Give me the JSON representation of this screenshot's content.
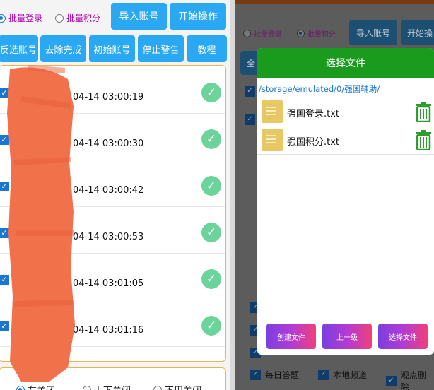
{
  "left": {
    "mode_options": [
      {
        "label": "批量登录",
        "selected": true
      },
      {
        "label": "批量积分",
        "selected": false
      }
    ],
    "import_button": "导入账号",
    "start_button": "开始操作",
    "toolbar": [
      "反选账号",
      "去除完成",
      "初始账号",
      "停止警告",
      "教程"
    ],
    "accounts": [
      {
        "time": "04-14 03:00:19",
        "checked": true,
        "done": true
      },
      {
        "time": "04-14 03:00:30",
        "checked": true,
        "done": true
      },
      {
        "time": "04-14 03:00:42",
        "checked": true,
        "done": true
      },
      {
        "time": "04-14 03:00:53",
        "checked": true,
        "done": true
      },
      {
        "time": "04-14 03:01:05",
        "checked": true,
        "done": true
      },
      {
        "time": "04-14 03:01:16",
        "checked": true,
        "done": true
      }
    ],
    "close_options": [
      "左关闭",
      "上下关闭",
      "不用关闭"
    ]
  },
  "right_background": {
    "mode_options": [
      {
        "label": "批量登录",
        "selected": false
      },
      {
        "label": "批量积分",
        "selected": true
      }
    ],
    "import_button": "导入账号",
    "start_button": "开始操",
    "side_button": "全",
    "bottom_options": [
      {
        "label": "每日答题",
        "checked": true
      },
      {
        "label": "本地频道",
        "checked": true
      },
      {
        "label": "观点删除",
        "checked": true
      }
    ]
  },
  "dialog": {
    "title": "选择文件",
    "path": "/storage/emulated/0/强国辅助/",
    "files": [
      {
        "name": "强国登录.txt"
      },
      {
        "name": "强国积分.txt"
      }
    ],
    "buttons": [
      "创建文件",
      "上一级",
      "选择文件"
    ]
  },
  "colors": {
    "accent_blue": "#2ba8f2",
    "dialog_green": "#1a9b1d",
    "done_green": "#6cd39b",
    "border_orange": "#f0b24a",
    "trash_green": "#2e9d2e",
    "scribble_orange": "#f0714a"
  }
}
